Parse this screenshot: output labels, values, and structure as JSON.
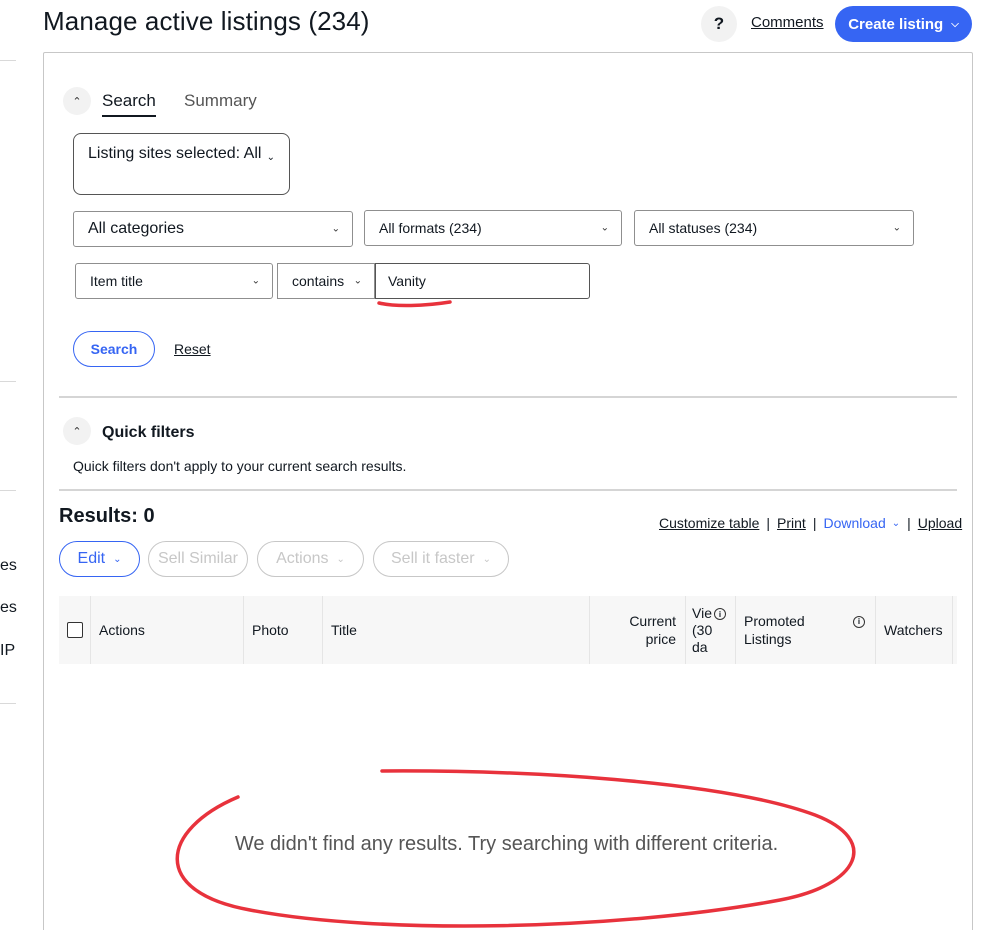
{
  "header": {
    "title": "Manage active listings (234)",
    "help_label": "?",
    "comments_label": "Comments",
    "create_label": "Create listing"
  },
  "sidebar": {
    "fragments": [
      "es",
      "es",
      "IP"
    ]
  },
  "search_panel": {
    "tabs": [
      {
        "label": "Search",
        "active": true
      },
      {
        "label": "Summary",
        "active": false
      }
    ],
    "listing_sites": "Listing sites selected: All",
    "categories": "All categories",
    "formats": "All formats (234)",
    "statuses": "All statuses (234)",
    "field": "Item title",
    "operator": "contains",
    "query_value": "Vanity",
    "search_button": "Search",
    "reset_link": "Reset"
  },
  "quick_filters": {
    "title": "Quick filters",
    "note": "Quick filters don't apply to your current search results."
  },
  "results": {
    "label": "Results: 0",
    "links": [
      "Customize table",
      "Print",
      "Download",
      "Upload"
    ],
    "separator": "|"
  },
  "actions_bar": {
    "edit": "Edit",
    "sell_similar": "Sell Similar",
    "actions": "Actions",
    "sell_faster": "Sell it faster"
  },
  "table": {
    "columns": [
      "Actions",
      "Photo",
      "Title",
      "Current price",
      "Vie (30 da",
      "Promoted Listings",
      "Watchers"
    ]
  },
  "empty_message": "We didn't find any results. Try searching with different criteria.",
  "colors": {
    "accent": "#3665f3",
    "annotation": "#e8323c"
  },
  "icons": [
    "chevron-down-icon",
    "chevron-up-icon",
    "info-icon",
    "help-icon"
  ]
}
